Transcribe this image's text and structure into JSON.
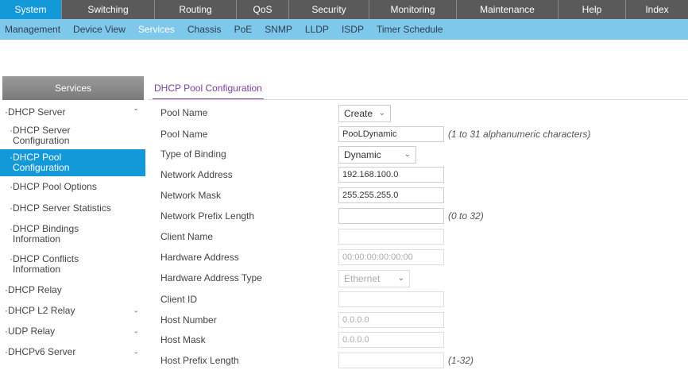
{
  "topnav": {
    "tabs": [
      {
        "label": "System",
        "active": true
      },
      {
        "label": "Switching",
        "active": false
      },
      {
        "label": "Routing",
        "active": false
      },
      {
        "label": "QoS",
        "active": false
      },
      {
        "label": "Security",
        "active": false
      },
      {
        "label": "Monitoring",
        "active": false
      },
      {
        "label": "Maintenance",
        "active": false
      },
      {
        "label": "Help",
        "active": false
      },
      {
        "label": "Index",
        "active": false
      }
    ]
  },
  "subnav": {
    "items": [
      {
        "label": "Management",
        "active": false
      },
      {
        "label": "Device View",
        "active": false
      },
      {
        "label": "Services",
        "active": true
      },
      {
        "label": "Chassis",
        "active": false
      },
      {
        "label": "PoE",
        "active": false
      },
      {
        "label": "SNMP",
        "active": false
      },
      {
        "label": "LLDP",
        "active": false
      },
      {
        "label": "ISDP",
        "active": false
      },
      {
        "label": "Timer Schedule",
        "active": false
      }
    ]
  },
  "sidebar": {
    "header": "Services",
    "items": [
      {
        "label": "DHCP Server",
        "level": "top",
        "chevron": "up"
      },
      {
        "label": "DHCP Server Configuration",
        "level": "sub"
      },
      {
        "label": "DHCP Pool Configuration",
        "level": "sub",
        "active": true
      },
      {
        "label": "DHCP Pool Options",
        "level": "sub"
      },
      {
        "label": "DHCP Server Statistics",
        "level": "sub"
      },
      {
        "label": "DHCP Bindings Information",
        "level": "sub"
      },
      {
        "label": "DHCP Conflicts Information",
        "level": "sub"
      },
      {
        "label": "DHCP Relay",
        "level": "top"
      },
      {
        "label": "DHCP L2 Relay",
        "level": "top",
        "chevron": "down"
      },
      {
        "label": "UDP Relay",
        "level": "top",
        "chevron": "down"
      },
      {
        "label": "DHCPv6 Server",
        "level": "top",
        "chevron": "down"
      }
    ]
  },
  "main": {
    "title": "DHCP Pool Configuration",
    "fields": {
      "pool_name_select": {
        "label": "Pool Name",
        "value": "Create"
      },
      "pool_name": {
        "label": "Pool Name",
        "value": "PooLDynamic",
        "hint": "(1 to 31 alphanumeric characters)"
      },
      "type_of_binding": {
        "label": "Type of Binding",
        "value": "Dynamic"
      },
      "network_address": {
        "label": "Network Address",
        "value": "192.168.100.0"
      },
      "network_mask": {
        "label": "Network Mask",
        "value": "255.255.255.0"
      },
      "network_prefix_length": {
        "label": "Network Prefix Length",
        "value": "",
        "hint": "(0 to 32)"
      },
      "client_name": {
        "label": "Client Name",
        "value": ""
      },
      "hardware_address": {
        "label": "Hardware Address",
        "value": "00:00:00:00:00:00"
      },
      "hardware_address_type": {
        "label": "Hardware Address Type",
        "value": "Ethernet"
      },
      "client_id": {
        "label": "Client ID",
        "value": ""
      },
      "host_number": {
        "label": "Host Number",
        "value": "0.0.0.0"
      },
      "host_mask": {
        "label": "Host Mask",
        "value": "0.0.0.0"
      },
      "host_prefix_length": {
        "label": "Host Prefix Length",
        "value": "",
        "hint": "(1-32)"
      }
    }
  },
  "colors": {
    "accent": "#1499d8",
    "subnav_bg": "#7ec8eb",
    "topnav_bg": "#5a5a5a",
    "title_purple": "#7b3fa0"
  }
}
